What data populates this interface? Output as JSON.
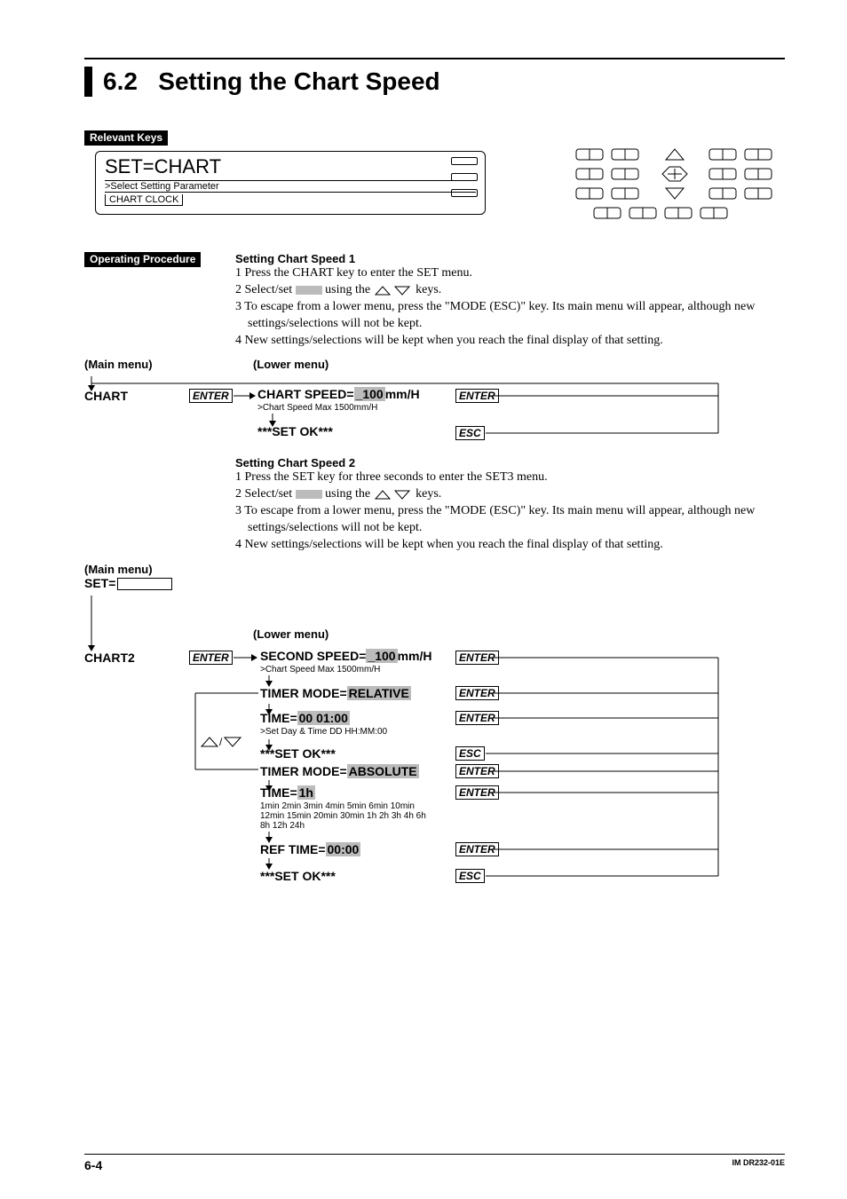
{
  "heading": {
    "number": "6.2",
    "title": "Setting the Chart Speed"
  },
  "labels": {
    "relevant_keys": "Relevant Keys",
    "operating_procedure": "Operating Procedure",
    "main_menu": "(Main menu)",
    "lower_menu": "(Lower menu)"
  },
  "keys": {
    "enter": "ENTER",
    "esc": "ESC"
  },
  "lcd": {
    "line1": "SET=CHART",
    "line2": ">Select Setting Parameter",
    "line3": "CHART  CLOCK"
  },
  "procedure1": {
    "title": "Setting Chart Speed 1",
    "s1": "1 Press the CHART key to enter the SET menu.",
    "s2a": "2 Select/set ",
    "s2b": " using the ",
    "s2c": " keys.",
    "s3": "3 To escape from a lower menu, press the \"MODE (ESC)\" key. Its main menu will appear, although new settings/selections will not be kept.",
    "s4": "4 New settings/selections will be kept when you reach the final display of that setting."
  },
  "flow1": {
    "main": "CHART",
    "lower1a": "CHART SPEED=",
    "lower1_val": "_100",
    "lower1b": "mm/H",
    "hint1": ">Chart Speed Max 1500mm/H",
    "setok": "***SET OK***"
  },
  "procedure2": {
    "title": "Setting Chart Speed 2",
    "s1": "1 Press the SET key for three seconds to enter the SET3 menu.",
    "s2a": "2 Select/set ",
    "s2b": " using the ",
    "s2c": " keys.",
    "s3": "3 To escape from a lower menu, press the \"MODE (ESC)\" key. Its main menu will appear, although new settings/selections will not be kept.",
    "s4": "4 New settings/selections will be kept when you reach the final display of that setting."
  },
  "flow2": {
    "set_eq": "SET=",
    "main": "CHART2",
    "l_second_a": "SECOND SPEED=",
    "l_second_val": "_100",
    "l_second_b": "mm/H",
    "hint_second": ">Chart Speed Max 1500mm/H",
    "l_timer_rel_a": "TIMER MODE=",
    "l_timer_rel_val": "RELATIVE",
    "l_time_a": "TIME=",
    "l_time_val": "00 01:00",
    "hint_time": ">Set Day & Time DD HH:MM:00",
    "setok1": "***SET OK***",
    "l_timer_abs_a": "TIMER MODE=",
    "l_timer_abs_val": "ABSOLUTE",
    "l_time2_a": "TIME=",
    "l_time2_val": "1h",
    "hint_time2a": "1min 2min 3min 4min 5min 6min 10min",
    "hint_time2b": "12min 15min 20min 30min 1h 2h 3h 4h 6h",
    "hint_time2c": "8h 12h 24h",
    "l_ref_a": "REF TIME=",
    "l_ref_val": "00:00",
    "setok2": "***SET OK***"
  },
  "footer": {
    "page": "6-4",
    "doc": "IM DR232-01E"
  }
}
